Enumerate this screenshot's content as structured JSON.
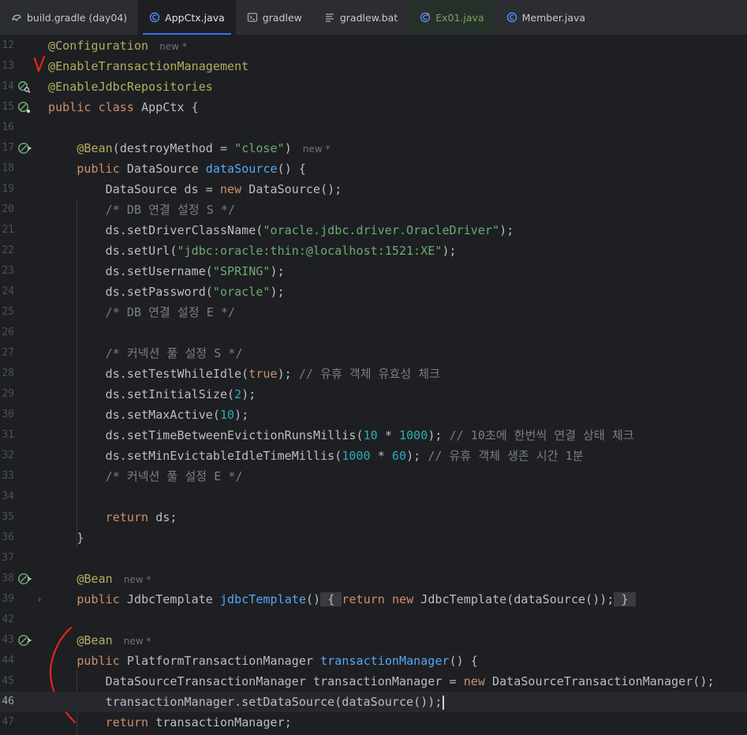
{
  "tabs": [
    {
      "label": "build.gradle (day04)",
      "icon": "gradle-icon",
      "icon_color": "#8fb9d4",
      "active": false,
      "text_color": "#c6c8cc"
    },
    {
      "label": "AppCtx.java",
      "icon": "java-class-icon",
      "icon_color": "#548af7",
      "active": true,
      "text_color": "#dfe1e5"
    },
    {
      "label": "gradlew",
      "icon": "terminal-file-icon",
      "icon_color": "#a8adb3",
      "active": false,
      "text_color": "#c6c8cc"
    },
    {
      "label": "gradlew.bat",
      "icon": "text-file-icon",
      "icon_color": "#a8adb3",
      "active": false,
      "text_color": "#c6c8cc"
    },
    {
      "label": "Ex01.java",
      "icon": "java-class-run-icon",
      "icon_color": "#548af7",
      "active": false,
      "text_color": "#7ea35e",
      "tint": "#25302a"
    },
    {
      "label": "Member.java",
      "icon": "java-class-icon",
      "icon_color": "#548af7",
      "active": false,
      "text_color": "#c6c8cc"
    }
  ],
  "colors": {
    "background": "#1e1f22",
    "current_line": "#26282e",
    "annotation": "#b3ae60",
    "keyword": "#cf8e6d",
    "string": "#6aab73",
    "number": "#2aacb8",
    "comment": "#7a7e85",
    "method": "#56a8f5",
    "text": "#bcbec4",
    "bean_icon": "#6aab73",
    "pen_mark": "#e0271b"
  },
  "lines": [
    {
      "n": "12",
      "gutter": "",
      "tokens": [
        [
          "ann",
          "@Configuration"
        ],
        [
          "hint",
          "new *"
        ]
      ]
    },
    {
      "n": "13",
      "gutter": "",
      "tokens": [
        [
          "ann",
          "@EnableTransactionManagement"
        ]
      ]
    },
    {
      "n": "14",
      "gutter": "bean-search-icon",
      "tokens": [
        [
          "ann",
          "@EnableJdbcRepositories"
        ]
      ]
    },
    {
      "n": "15",
      "gutter": "bean-config-icon",
      "tokens": [
        [
          "kw",
          "public class "
        ],
        [
          "txt",
          "AppCtx {"
        ]
      ]
    },
    {
      "n": "16",
      "gutter": "",
      "tokens": []
    },
    {
      "n": "17",
      "gutter": "bean-method-icon",
      "tokens": [
        [
          "txt",
          "    "
        ],
        [
          "ann",
          "@Bean"
        ],
        [
          "txt",
          "(destroyMethod = "
        ],
        [
          "str",
          "\"close\""
        ],
        [
          "txt",
          ")"
        ],
        [
          "hint",
          "new *"
        ]
      ]
    },
    {
      "n": "18",
      "gutter": "",
      "tokens": [
        [
          "txt",
          "    "
        ],
        [
          "kw",
          "public "
        ],
        [
          "txt",
          "DataSource "
        ],
        [
          "fn",
          "dataSource"
        ],
        [
          "txt",
          "() {"
        ]
      ]
    },
    {
      "n": "19",
      "gutter": "",
      "tokens": [
        [
          "txt",
          "        DataSource ds = "
        ],
        [
          "kw",
          "new "
        ],
        [
          "txt",
          "DataSource();"
        ]
      ]
    },
    {
      "n": "20",
      "gutter": "",
      "tokens": [
        [
          "txt",
          "        "
        ],
        [
          "cm",
          "/* DB 연결 설정 S */"
        ]
      ]
    },
    {
      "n": "21",
      "gutter": "",
      "tokens": [
        [
          "txt",
          "        ds.setDriverClassName("
        ],
        [
          "str",
          "\"oracle.jdbc.driver.OracleDriver\""
        ],
        [
          "txt",
          ");"
        ]
      ]
    },
    {
      "n": "22",
      "gutter": "",
      "tokens": [
        [
          "txt",
          "        ds.setUrl("
        ],
        [
          "str",
          "\"jdbc:oracle:thin:@localhost:1521:XE\""
        ],
        [
          "txt",
          ");"
        ]
      ]
    },
    {
      "n": "23",
      "gutter": "",
      "tokens": [
        [
          "txt",
          "        ds.setUsername("
        ],
        [
          "str",
          "\"SPRING\""
        ],
        [
          "txt",
          ");"
        ]
      ]
    },
    {
      "n": "24",
      "gutter": "",
      "tokens": [
        [
          "txt",
          "        ds.setPassword("
        ],
        [
          "str",
          "\"oracle\""
        ],
        [
          "txt",
          ");"
        ]
      ]
    },
    {
      "n": "25",
      "gutter": "",
      "tokens": [
        [
          "txt",
          "        "
        ],
        [
          "cm",
          "/* DB 연결 설정 E */"
        ]
      ]
    },
    {
      "n": "26",
      "gutter": "",
      "tokens": []
    },
    {
      "n": "27",
      "gutter": "",
      "tokens": [
        [
          "txt",
          "        "
        ],
        [
          "cm",
          "/* 커넥션 풀 설정 S */"
        ]
      ]
    },
    {
      "n": "28",
      "gutter": "",
      "tokens": [
        [
          "txt",
          "        ds.setTestWhileIdle("
        ],
        [
          "kw",
          "true"
        ],
        [
          "txt",
          ");"
        ],
        [
          "cm",
          " // 유휴 객체 유효성 체크"
        ]
      ]
    },
    {
      "n": "29",
      "gutter": "",
      "tokens": [
        [
          "txt",
          "        ds.setInitialSize("
        ],
        [
          "num",
          "2"
        ],
        [
          "txt",
          ");"
        ]
      ]
    },
    {
      "n": "30",
      "gutter": "",
      "tokens": [
        [
          "txt",
          "        ds.setMaxActive("
        ],
        [
          "num",
          "10"
        ],
        [
          "txt",
          ");"
        ]
      ]
    },
    {
      "n": "31",
      "gutter": "",
      "tokens": [
        [
          "txt",
          "        ds.setTimeBetweenEvictionRunsMillis("
        ],
        [
          "num",
          "10"
        ],
        [
          "txt",
          " * "
        ],
        [
          "num",
          "1000"
        ],
        [
          "txt",
          ");"
        ],
        [
          "cm",
          " // 10초에 한번씩 연결 상태 체크"
        ]
      ]
    },
    {
      "n": "32",
      "gutter": "",
      "tokens": [
        [
          "txt",
          "        ds.setMinEvictableIdleTimeMillis("
        ],
        [
          "num",
          "1000"
        ],
        [
          "txt",
          " * "
        ],
        [
          "num",
          "60"
        ],
        [
          "txt",
          ");"
        ],
        [
          "cm",
          " // 유휴 객체 생존 시간 1분"
        ]
      ]
    },
    {
      "n": "33",
      "gutter": "",
      "tokens": [
        [
          "txt",
          "        "
        ],
        [
          "cm",
          "/* 커넥션 풀 설정 E */"
        ]
      ]
    },
    {
      "n": "34",
      "gutter": "",
      "tokens": []
    },
    {
      "n": "35",
      "gutter": "",
      "tokens": [
        [
          "txt",
          "        "
        ],
        [
          "kw",
          "return "
        ],
        [
          "txt",
          "ds;"
        ]
      ]
    },
    {
      "n": "36",
      "gutter": "",
      "tokens": [
        [
          "txt",
          "    }"
        ]
      ]
    },
    {
      "n": "37",
      "gutter": "",
      "tokens": []
    },
    {
      "n": "38",
      "gutter": "bean-method-icon",
      "tokens": [
        [
          "txt",
          "    "
        ],
        [
          "ann",
          "@Bean"
        ],
        [
          "hint",
          "new *"
        ]
      ]
    },
    {
      "n": "39",
      "gutter": "",
      "fold": "›",
      "tokens": [
        [
          "txt",
          "    "
        ],
        [
          "kw",
          "public "
        ],
        [
          "txt",
          "JdbcTemplate "
        ],
        [
          "fn",
          "jdbcTemplate"
        ],
        [
          "txt",
          "()"
        ],
        [
          "brace",
          " { "
        ],
        [
          "kw",
          "return new "
        ],
        [
          "txt",
          "JdbcTemplate(dataSource());"
        ],
        [
          "brace",
          " } "
        ]
      ]
    },
    {
      "n": "42",
      "gutter": "",
      "tokens": []
    },
    {
      "n": "43",
      "gutter": "bean-method-icon",
      "tokens": [
        [
          "txt",
          "    "
        ],
        [
          "ann",
          "@Bean"
        ],
        [
          "hint",
          "new *"
        ]
      ]
    },
    {
      "n": "44",
      "gutter": "",
      "tokens": [
        [
          "txt",
          "    "
        ],
        [
          "kw",
          "public "
        ],
        [
          "txt",
          "PlatformTransactionManager "
        ],
        [
          "fn",
          "transactionManager"
        ],
        [
          "txt",
          "() {"
        ]
      ]
    },
    {
      "n": "45",
      "gutter": "",
      "tokens": [
        [
          "txt",
          "        DataSourceTransactionManager transactionManager = "
        ],
        [
          "kw",
          "new "
        ],
        [
          "txt",
          "DataSourceTransactionManager();"
        ]
      ]
    },
    {
      "n": "46",
      "gutter": "",
      "current": true,
      "tokens": [
        [
          "txt",
          "        transactionManager.setDataSource(dataSource());"
        ],
        [
          "caret",
          ""
        ]
      ]
    },
    {
      "n": "47",
      "gutter": "",
      "tokens": [
        [
          "txt",
          "        "
        ],
        [
          "kw",
          "return "
        ],
        [
          "txt",
          "transactionManager;"
        ]
      ]
    }
  ]
}
